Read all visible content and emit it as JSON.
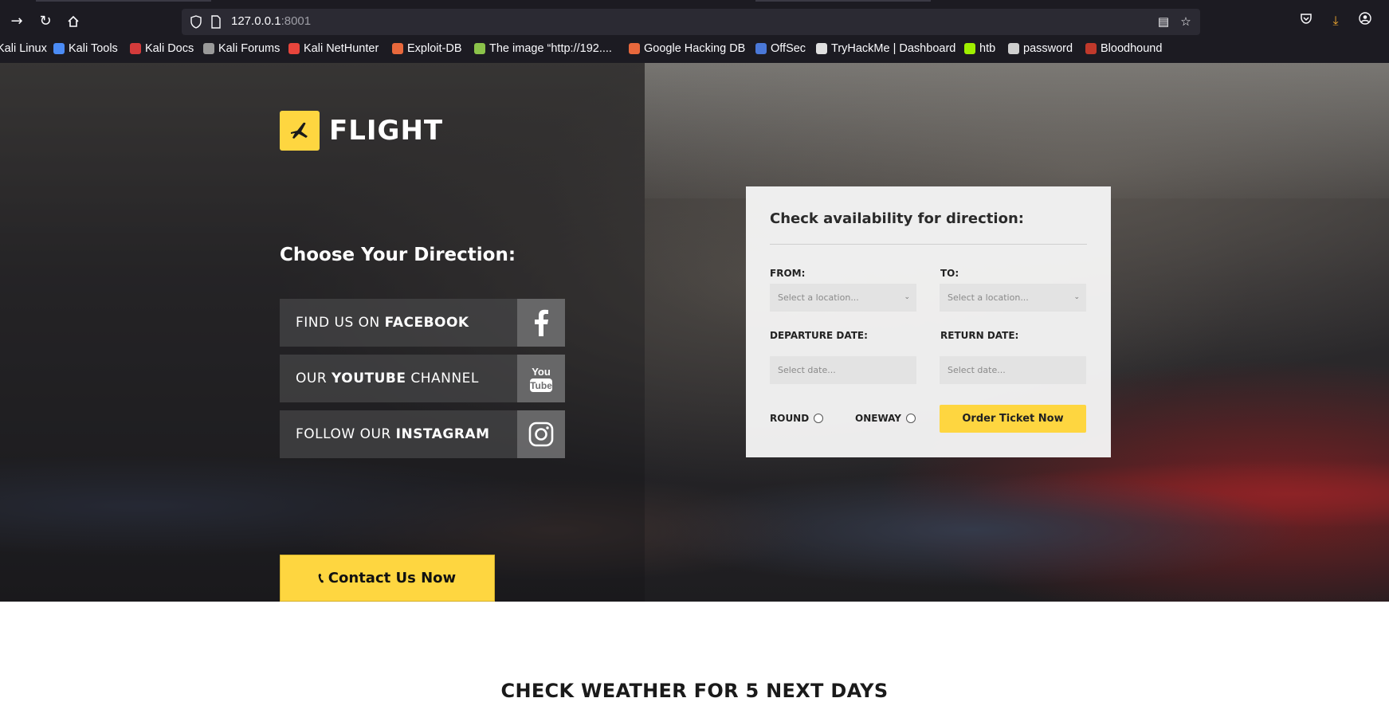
{
  "browser": {
    "url_host": "127.0.0.1",
    "url_port": ":8001",
    "bookmarks": [
      {
        "label": "Kali Linux",
        "icon": "kali-icon",
        "color": "#367bf0"
      },
      {
        "label": "Kali Tools",
        "icon": "kali-tools-icon",
        "color": "#4b8bf5"
      },
      {
        "label": "Kali Docs",
        "icon": "kali-docs-icon",
        "color": "#d43b3b"
      },
      {
        "label": "Kali Forums",
        "icon": "kali-forums-icon",
        "color": "#9a9a9a"
      },
      {
        "label": "Kali NetHunter",
        "icon": "nethunter-icon",
        "color": "#e8453c"
      },
      {
        "label": "Exploit-DB",
        "icon": "exploit-db-icon",
        "color": "#e8683c"
      },
      {
        "label": "The image “http://192....",
        "icon": "image-icon",
        "color": "#8bc34a"
      },
      {
        "label": "Google Hacking DB",
        "icon": "ghdb-icon",
        "color": "#e8683c"
      },
      {
        "label": "OffSec",
        "icon": "offsec-icon",
        "color": "#4a78d8"
      },
      {
        "label": "TryHackMe | Dashboard",
        "icon": "tryhackme-icon",
        "color": "#e0e0e0"
      },
      {
        "label": "htb",
        "icon": "htb-icon",
        "color": "#9fef00"
      },
      {
        "label": "password",
        "icon": "globe-icon",
        "color": "#cfcfcf"
      },
      {
        "label": "Bloodhound",
        "icon": "bloodhound-icon",
        "color": "#c0392b"
      }
    ]
  },
  "hero": {
    "logo_text": "FLIGHT",
    "direction_title": "Choose Your Direction:",
    "social": [
      {
        "prefix": "FIND US ON ",
        "bold": "FACEBOOK",
        "suffix": "",
        "icon": "facebook-icon"
      },
      {
        "prefix": "OUR ",
        "bold": "YOUTUBE",
        "suffix": " CHANNEL",
        "icon": "youtube-icon"
      },
      {
        "prefix": "FOLLOW OUR ",
        "bold": "INSTAGRAM",
        "suffix": "",
        "icon": "instagram-icon"
      }
    ],
    "contact_label": "Contact Us Now",
    "accent_color": "#fed640"
  },
  "form": {
    "title": "Check availability for direction:",
    "from_label": "FROM:",
    "to_label": "TO:",
    "from_placeholder": "Select a location...",
    "to_placeholder": "Select a location...",
    "departure_label": "DEPARTURE DATE:",
    "return_label": "RETURN DATE:",
    "departure_placeholder": "Select date...",
    "return_placeholder": "Select date...",
    "round_label": "ROUND",
    "oneway_label": "ONEWAY",
    "order_label": "Order Ticket Now"
  },
  "weather": {
    "title": "CHECK WEATHER FOR 5 NEXT DAYS"
  }
}
